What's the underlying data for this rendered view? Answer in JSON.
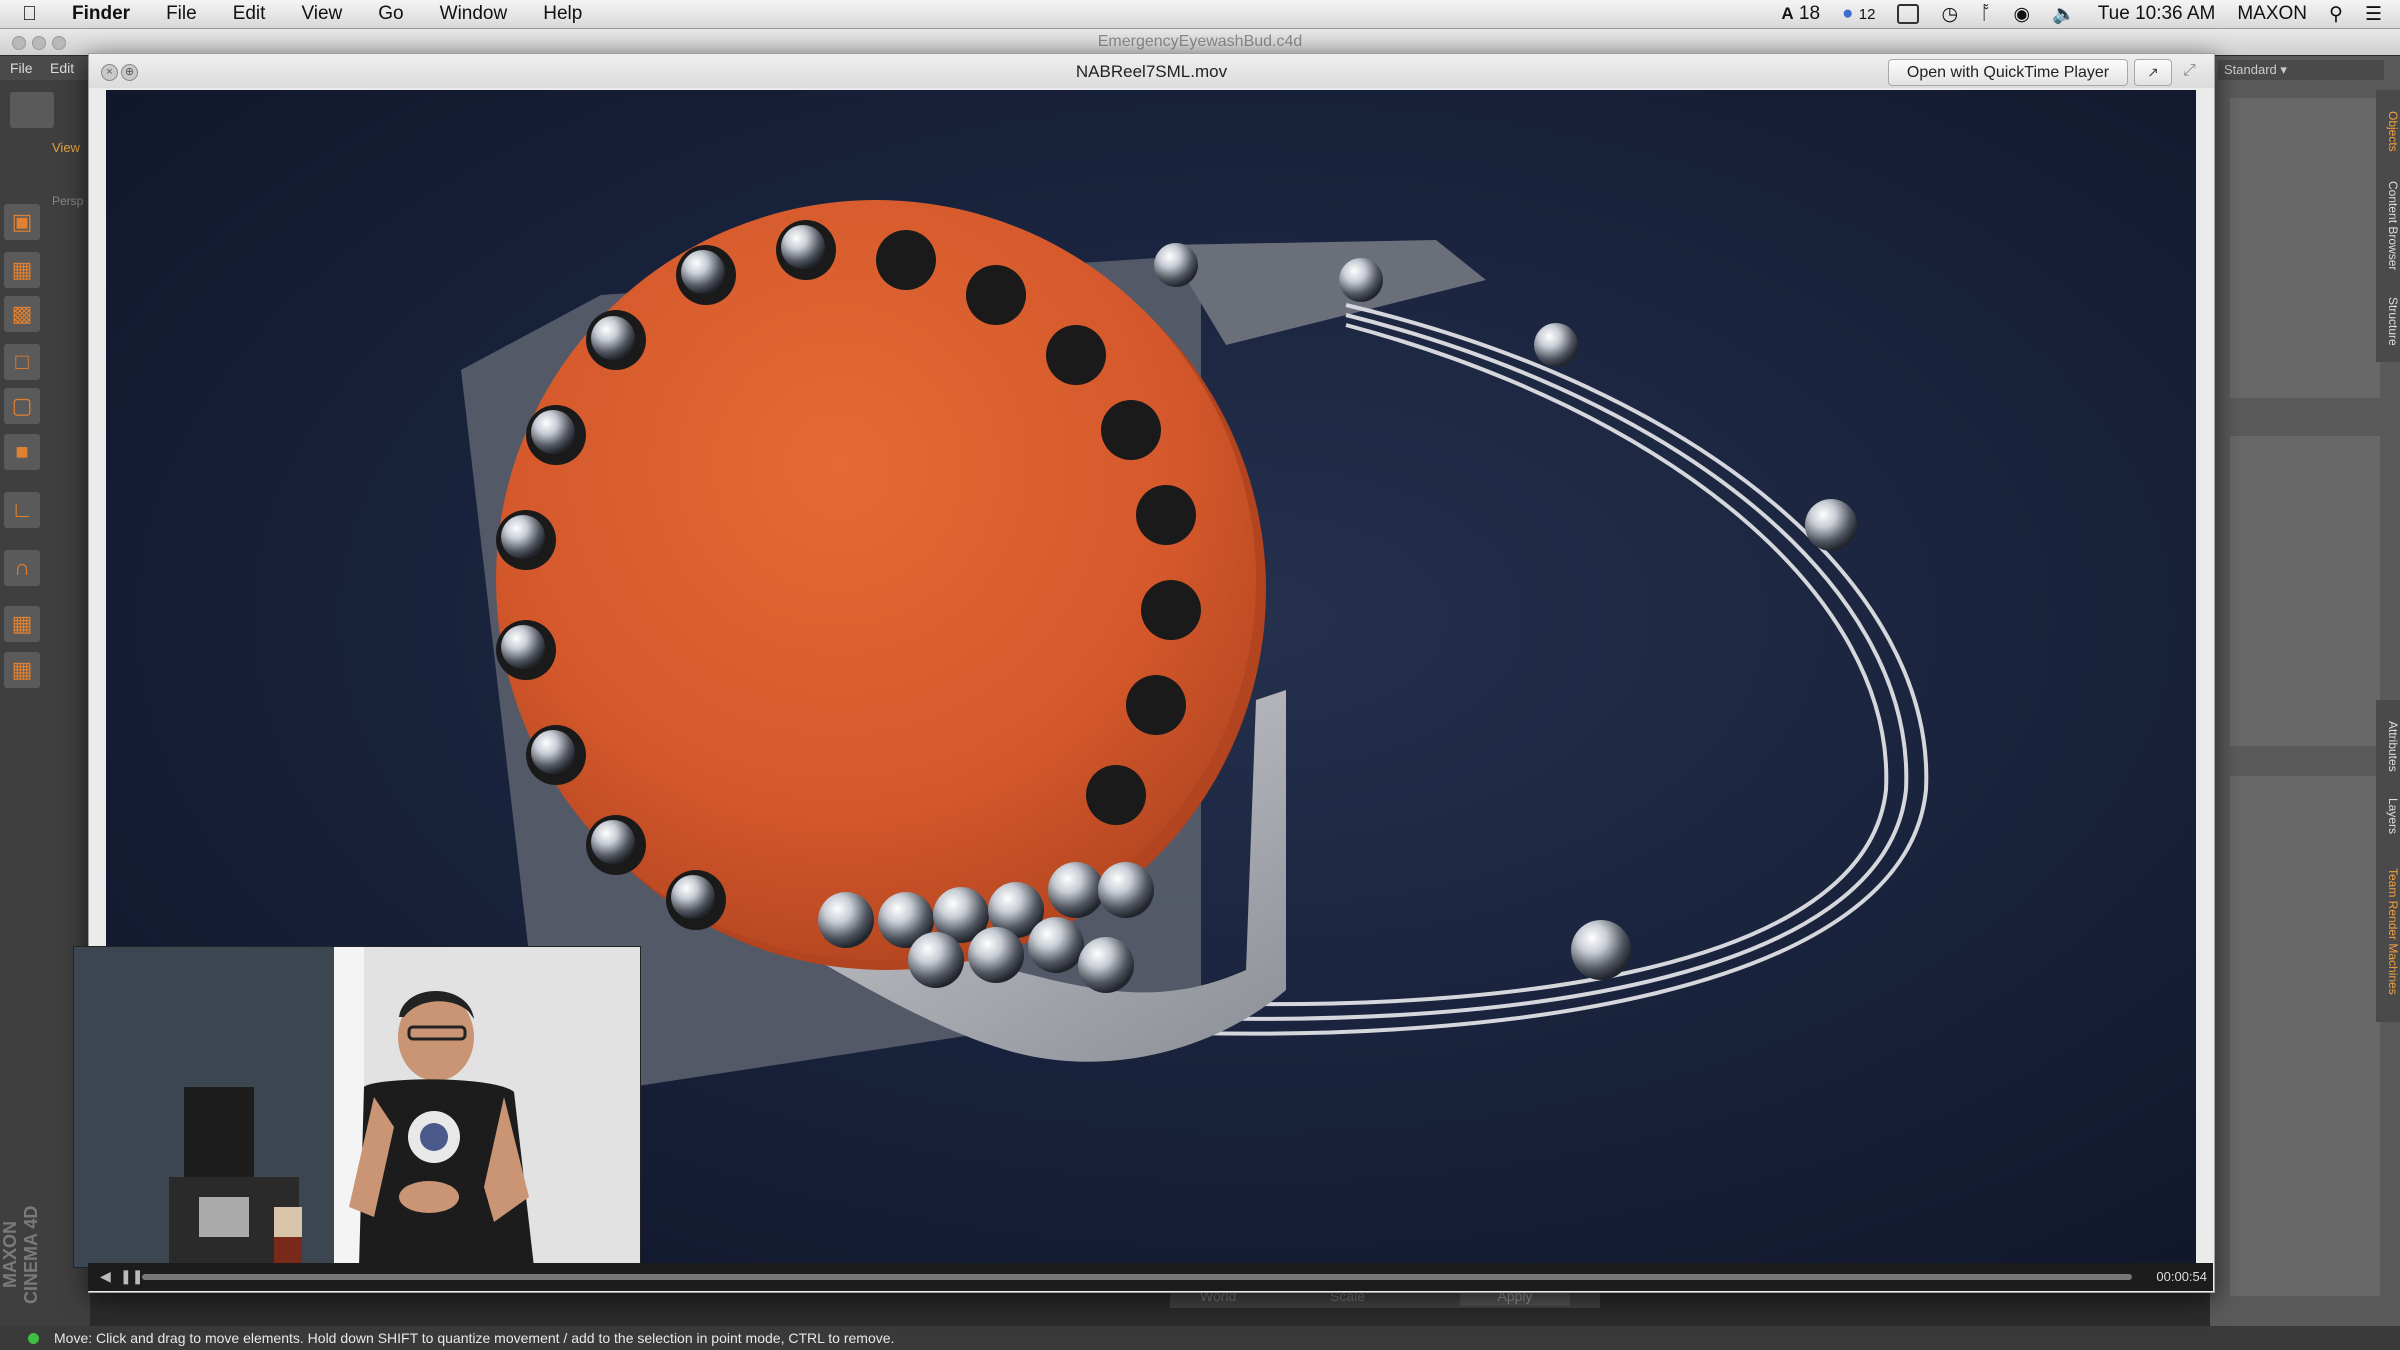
{
  "menubar": {
    "app": "Finder",
    "menus": [
      "File",
      "Edit",
      "View",
      "Go",
      "Window",
      "Help"
    ],
    "status": {
      "adobe_count": "18",
      "cc_count": "12",
      "clock": "Tue 10:36 AM",
      "user": "MAXON"
    }
  },
  "c4d": {
    "window_title": "EmergencyEyewashBud.c4d",
    "menus": [
      "File",
      "Edit"
    ],
    "viewport_tab": "View",
    "viewport_label": "Persp",
    "layout_dropdown": "Standard",
    "right_tabs": [
      "Objects",
      "Content Browser",
      "Structure",
      "Attributes",
      "Layers",
      "Team Render Machines"
    ],
    "status_message": "Move: Click and drag to move elements. Hold down SHIFT to quantize movement / add to the selection in point mode, CTRL to remove.",
    "bottom_fields": [
      "World",
      "Scale",
      "Apply"
    ],
    "logo": "MAXON CINEMA 4D"
  },
  "quicklook": {
    "filename": "NABReel7SML.mov",
    "open_button": "Open with QuickTime Player",
    "timecode": "00:00:54",
    "progress": 0.0
  },
  "icons": {
    "apple": "apple-icon",
    "search": "spotlight-search-icon",
    "list": "notification-list-icon",
    "wifi": "wifi-icon",
    "volume": "volume-icon",
    "bluetooth": "bluetooth-icon",
    "time_machine": "time-machine-icon"
  },
  "colors": {
    "disc": "#d4582b",
    "video_bg": "#1a2440",
    "status_green": "#3fbf3f"
  }
}
